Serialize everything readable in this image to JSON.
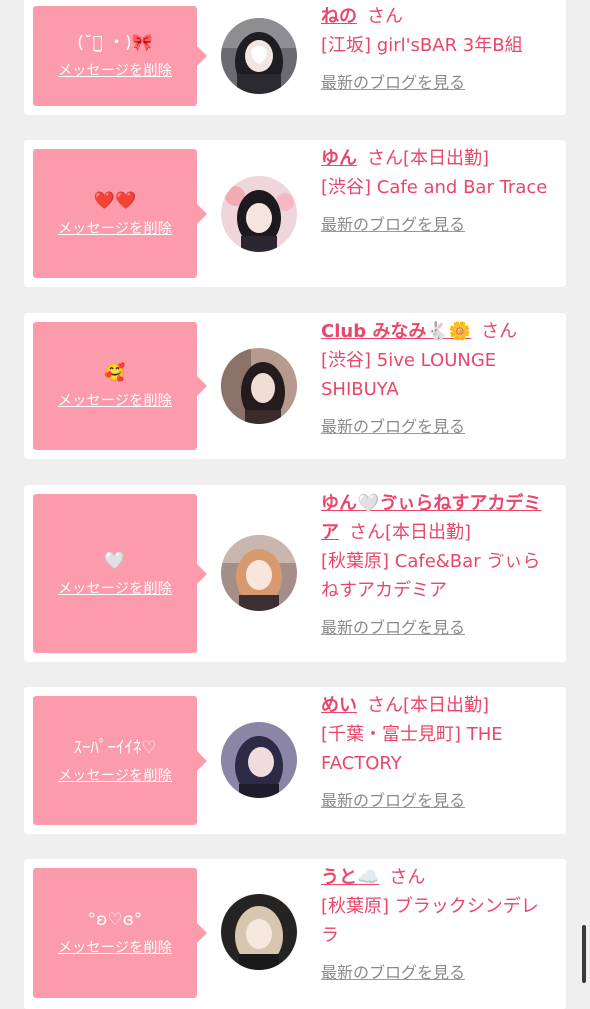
{
  "delete_label": "メッセージを削除",
  "blog_label": "最新のブログを見る",
  "san_label": "さん",
  "entries": [
    {
      "message": "(˘っ̫ ・)🎀",
      "name": "ねの",
      "status": "",
      "shop": "[江坂] girl'sBAR 3年B組"
    },
    {
      "message": "❤️❤️",
      "name": "ゆん",
      "status": "[本日出勤]",
      "shop": "[渋谷] Cafe and Bar Trace"
    },
    {
      "message": "🥰",
      "name": "Club みなみ🐇🌼",
      "status": "",
      "shop": "[渋谷] 5ive LOUNGE SHIBUYA"
    },
    {
      "message": "🤍",
      "name": "ゆん🤍ゔぃらねすアカデミア",
      "status": "[本日出勤]",
      "shop": "[秋葉原] Cafe&Bar ゔぃらねすアカデミア"
    },
    {
      "message": "ｽｰﾊﾟｰｲｲﾈ♡",
      "name": "めい",
      "status": "[本日出勤]",
      "shop": "[千葉・富士見町] THE FACTORY"
    },
    {
      "message": "°ʚ♡ɞ°",
      "name": "うと☁️",
      "status": "",
      "shop": "[秋葉原] ブラックシンデレラ"
    }
  ],
  "colors": {
    "accent": "#e8476b",
    "bubble": "#fc9bab",
    "background": "#efeff0"
  }
}
